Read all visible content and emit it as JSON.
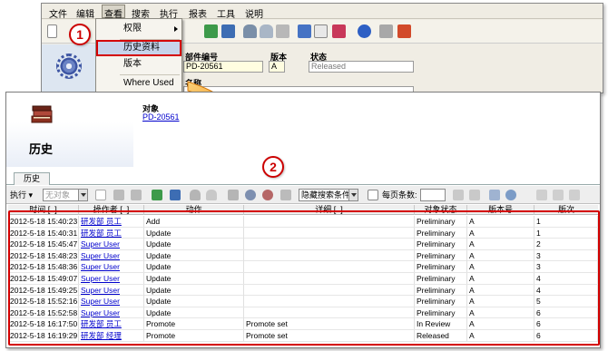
{
  "background_window": {
    "menubar": [
      "文件",
      "编辑",
      "查看",
      "搜索",
      "执行",
      "报表",
      "工具",
      "说明"
    ],
    "active_menu": "查看",
    "dropdown": {
      "items": [
        {
          "label": "权限",
          "has_submenu": true
        },
        {
          "label": "历史资料",
          "highlighted": true
        },
        {
          "label": "版本"
        },
        {
          "label": "Where Used"
        }
      ]
    },
    "fields": {
      "part_number_label": "部件编号",
      "part_number_value": "PD-20561",
      "version_label": "版本",
      "version_value": "A",
      "state_label": "状态",
      "state_value": "Released",
      "name_label": "名称"
    }
  },
  "callouts": {
    "step1": "1",
    "step2": "2"
  },
  "main_window": {
    "title": "历史",
    "object_label": "对象",
    "object_link": "PD-20561",
    "tab": "历史",
    "toolbar": {
      "execute_label": "执行",
      "object_select": "无对象",
      "hidden_search": "隐藏搜索条件",
      "page_size_label": "每页条数:"
    },
    "table": {
      "columns": [
        "时间 [..]",
        "操作者 [..]",
        "动作",
        "详细 [..]",
        "对象状态",
        "版本号",
        "版次"
      ],
      "rows": [
        {
          "time": "2012-5-18 15:40:23",
          "user": "研发部 员工",
          "action": "Add",
          "detail": "",
          "state": "Preliminary",
          "version": "A",
          "rev": "1"
        },
        {
          "time": "2012-5-18 15:40:31",
          "user": "研发部 员工",
          "action": "Update",
          "detail": "",
          "state": "Preliminary",
          "version": "A",
          "rev": "1"
        },
        {
          "time": "2012-5-18 15:45:47",
          "user": "Super User",
          "action": "Update",
          "detail": "",
          "state": "Preliminary",
          "version": "A",
          "rev": "2"
        },
        {
          "time": "2012-5-18 15:48:23",
          "user": "Super User",
          "action": "Update",
          "detail": "",
          "state": "Preliminary",
          "version": "A",
          "rev": "3"
        },
        {
          "time": "2012-5-18 15:48:36",
          "user": "Super User",
          "action": "Update",
          "detail": "",
          "state": "Preliminary",
          "version": "A",
          "rev": "3"
        },
        {
          "time": "2012-5-18 15:49:07",
          "user": "Super User",
          "action": "Update",
          "detail": "",
          "state": "Preliminary",
          "version": "A",
          "rev": "4"
        },
        {
          "time": "2012-5-18 15:49:25",
          "user": "Super User",
          "action": "Update",
          "detail": "",
          "state": "Preliminary",
          "version": "A",
          "rev": "4"
        },
        {
          "time": "2012-5-18 15:52:16",
          "user": "Super User",
          "action": "Update",
          "detail": "",
          "state": "Preliminary",
          "version": "A",
          "rev": "5"
        },
        {
          "time": "2012-5-18 15:52:58",
          "user": "Super User",
          "action": "Update",
          "detail": "",
          "state": "Preliminary",
          "version": "A",
          "rev": "6"
        },
        {
          "time": "2012-5-18 16:17:50",
          "user": "研发部 员工",
          "action": "Promote",
          "detail": "Promote set",
          "state": "In Review",
          "version": "A",
          "rev": "6"
        },
        {
          "time": "2012-5-18 16:19:29",
          "user": "研发部 经理",
          "action": "Promote",
          "detail": "Promote set",
          "state": "Released",
          "version": "A",
          "rev": "6"
        }
      ]
    }
  },
  "colors": {
    "highlight_red": "#d40000",
    "link_blue": "#0000cc",
    "arrow_orange": "#f29a1d"
  }
}
